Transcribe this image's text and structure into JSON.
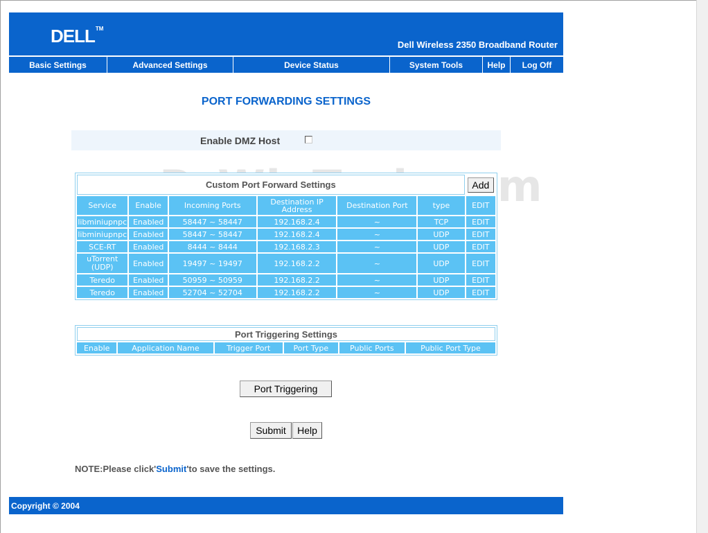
{
  "header": {
    "logo": "DELL",
    "logo_mark": "TM",
    "product": "Dell Wireless 2350 Broadband Router"
  },
  "nav": [
    {
      "label": "Basic Settings"
    },
    {
      "label": "Advanced Settings"
    },
    {
      "label": "Device Status"
    },
    {
      "label": "System Tools"
    },
    {
      "label": "Help"
    },
    {
      "label": "Log Off"
    }
  ],
  "page_title": "PORT FORWARDING SETTINGS",
  "dmz": {
    "label": "Enable DMZ Host",
    "checked": false
  },
  "port_forward": {
    "title": "Custom Port Forward Settings",
    "add_label": "Add",
    "columns": [
      "Service",
      "Enable",
      "Incoming Ports",
      "Destination IP Address",
      "Destination Port",
      "type",
      "EDIT"
    ],
    "rows": [
      [
        "libminiupnpc",
        "Enabled",
        "58447 ~ 58447",
        "192.168.2.4",
        "~",
        "TCP",
        "EDIT"
      ],
      [
        "libminiupnpc",
        "Enabled",
        "58447 ~ 58447",
        "192.168.2.4",
        "~",
        "UDP",
        "EDIT"
      ],
      [
        "SCE-RT",
        "Enabled",
        "8444 ~ 8444",
        "192.168.2.3",
        "~",
        "UDP",
        "EDIT"
      ],
      [
        "uTorrent (UDP)",
        "Enabled",
        "19497 ~ 19497",
        "192.168.2.2",
        "~",
        "UDP",
        "EDIT"
      ],
      [
        "Teredo",
        "Enabled",
        "50959 ~ 50959",
        "192.168.2.2",
        "~",
        "UDP",
        "EDIT"
      ],
      [
        "Teredo",
        "Enabled",
        "52704 ~ 52704",
        "192.168.2.2",
        "~",
        "UDP",
        "EDIT"
      ]
    ]
  },
  "port_trigger": {
    "title": "Port Triggering Settings",
    "columns": [
      "Enable",
      "Application Name",
      "Trigger Port",
      "Port Type",
      "Public Ports",
      "Public Port Type"
    ]
  },
  "buttons": {
    "port_triggering": "Port Triggering",
    "submit": "Submit",
    "help": "Help"
  },
  "note": {
    "prefix": "NOTE:Please click'",
    "highlight": "Submit",
    "suffix": "'to save the settings."
  },
  "footer": {
    "copyright": "Copyright © 2004"
  },
  "watermark": "PcWinTech.com",
  "colors": {
    "brand": "#0a64cc",
    "cell": "#5bc2f4"
  }
}
